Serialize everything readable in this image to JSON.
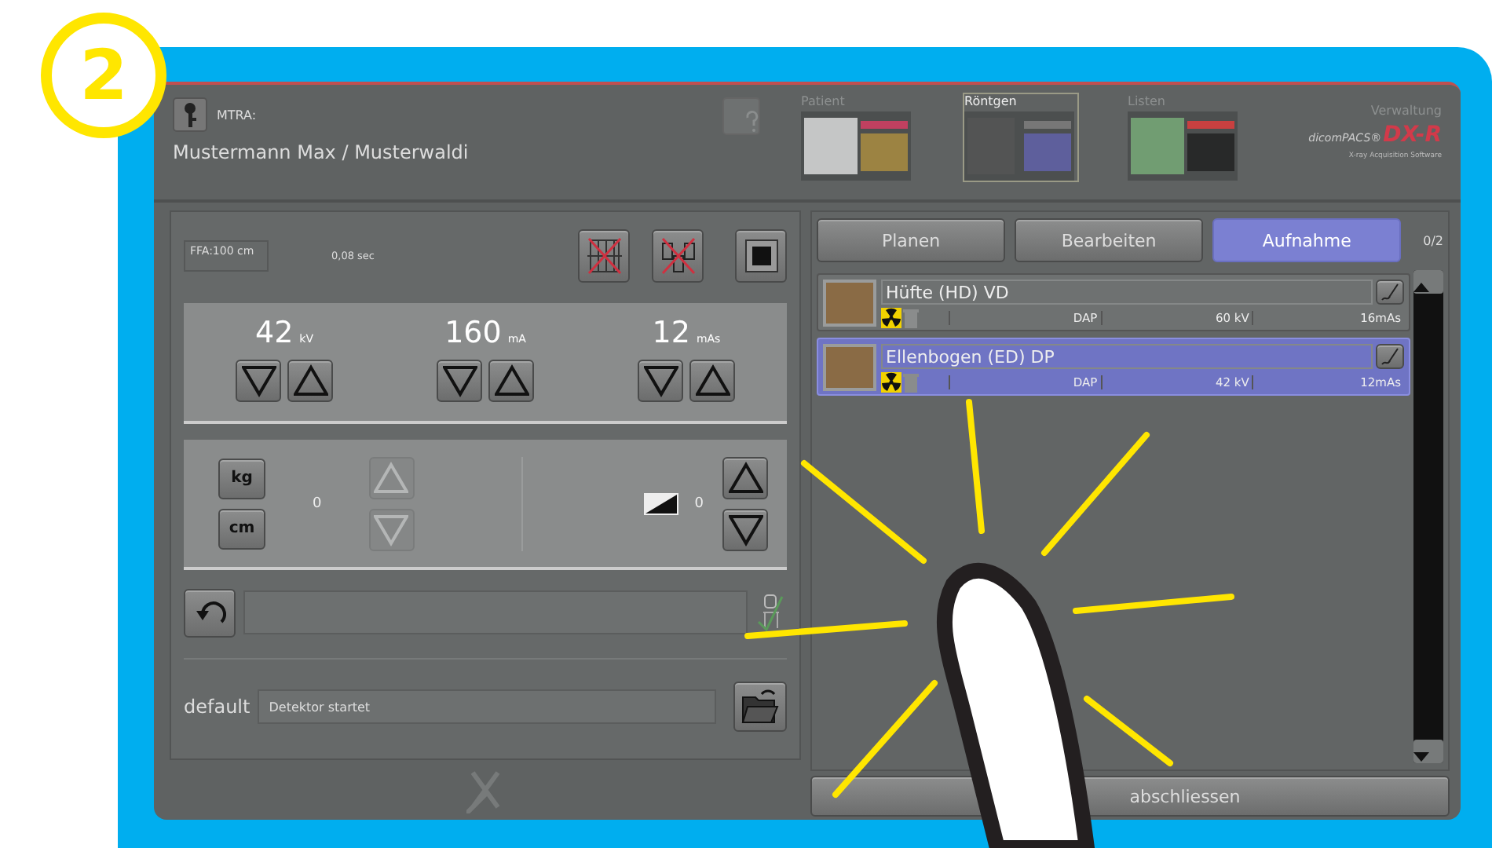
{
  "badge": {
    "label": "2"
  },
  "header": {
    "operator_label": "MTRA:",
    "patient": "Mustermann Max / Musterwaldi",
    "nav_tabs": [
      {
        "label": "Patient",
        "selected": false
      },
      {
        "label": "Röntgen",
        "selected": true
      },
      {
        "label": "Listen",
        "selected": false
      },
      {
        "label": "Verwaltung",
        "selected": false
      }
    ],
    "logo": {
      "brand": "dicomPACS®",
      "product": "DX-R",
      "tagline": "X-ray Acquisition Software"
    }
  },
  "exposure": {
    "ffa": "FFA:100 cm",
    "time": "0,08 sec",
    "params": [
      {
        "value": "42",
        "unit": "kV"
      },
      {
        "value": "160",
        "unit": "mA"
      },
      {
        "value": "12",
        "unit": "mAs"
      }
    ]
  },
  "patient_size": {
    "buttons": [
      "kg",
      "cm"
    ],
    "value": "0"
  },
  "density": {
    "value": "0"
  },
  "status": {
    "label": "default",
    "value": "Detektor startet"
  },
  "mode_tabs": [
    {
      "label": "Planen",
      "selected": false
    },
    {
      "label": "Bearbeiten",
      "selected": false
    },
    {
      "label": "Aufnahme",
      "selected": true
    }
  ],
  "counter": "0/2",
  "exams": [
    {
      "name": "Hüfte (HD) VD",
      "selected": false,
      "cells": [
        "DAP",
        "60 kV",
        "16mAs"
      ]
    },
    {
      "name": "Ellenbogen (ED) DP",
      "selected": true,
      "cells": [
        "DAP",
        "42 kV",
        "12mAs"
      ]
    }
  ],
  "finish_button": "abschliessen"
}
